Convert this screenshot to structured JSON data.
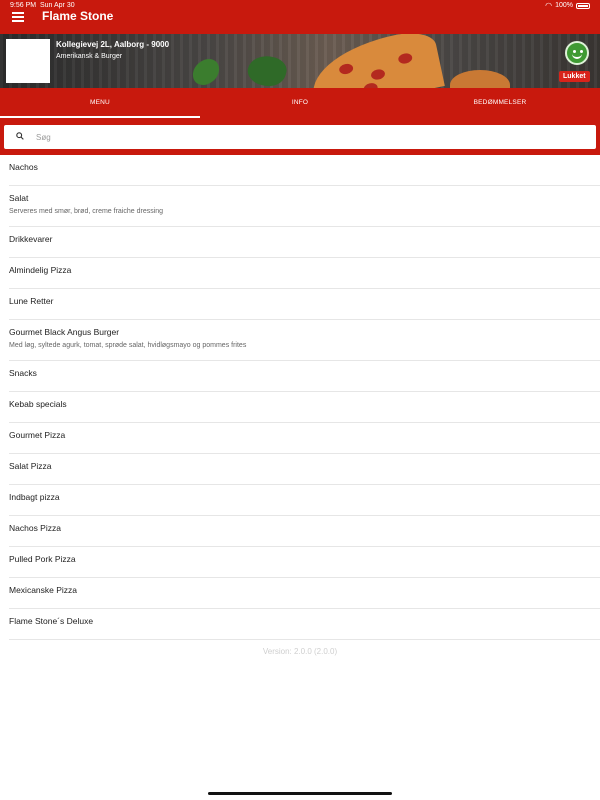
{
  "status_bar": {
    "time": "9:56 PM",
    "date": "Sun Apr 30",
    "battery": "100%"
  },
  "app": {
    "title": "Flame Stone"
  },
  "restaurant": {
    "address": "Kollegievej 2L, Aalborg - 9000",
    "cuisine": "Amerikansk & Burger",
    "status": "Lukket"
  },
  "tabs": [
    {
      "label": "MENU"
    },
    {
      "label": "INFO"
    },
    {
      "label": "BEDØMMELSER"
    }
  ],
  "search": {
    "placeholder": "Søg",
    "value": ""
  },
  "menu_items": [
    {
      "name": "Nachos",
      "description": ""
    },
    {
      "name": "Salat",
      "description": "Serveres med smør, brød, creme fraiche dressing"
    },
    {
      "name": "Drikkevarer",
      "description": ""
    },
    {
      "name": "Almindelig Pizza",
      "description": ""
    },
    {
      "name": "Lune Retter",
      "description": ""
    },
    {
      "name": "Gourmet Black Angus Burger",
      "description": "Med løg, syltede agurk, tomat, sprøde salat, hvidløgsmayo og pommes frites"
    },
    {
      "name": "Snacks",
      "description": ""
    },
    {
      "name": "Kebab specials",
      "description": ""
    },
    {
      "name": "Gourmet Pizza",
      "description": ""
    },
    {
      "name": "Salat Pizza",
      "description": ""
    },
    {
      "name": "Indbagt pizza",
      "description": ""
    },
    {
      "name": "Nachos Pizza",
      "description": ""
    },
    {
      "name": "Pulled Pork Pizza",
      "description": ""
    },
    {
      "name": "Mexicanske Pizza",
      "description": ""
    },
    {
      "name": "Flame Stone´s Deluxe",
      "description": ""
    }
  ],
  "footer": {
    "version": "Version: 2.0.0 (2.0.0)"
  },
  "colors": {
    "accent": "#c8190d",
    "badge": "#d8231a",
    "smiley": "#3f9a33"
  },
  "icons": {
    "menu": "hamburger-icon",
    "search": "search-icon",
    "wifi": "wifi-icon",
    "battery": "battery-icon",
    "smiley": "smiley-icon"
  }
}
